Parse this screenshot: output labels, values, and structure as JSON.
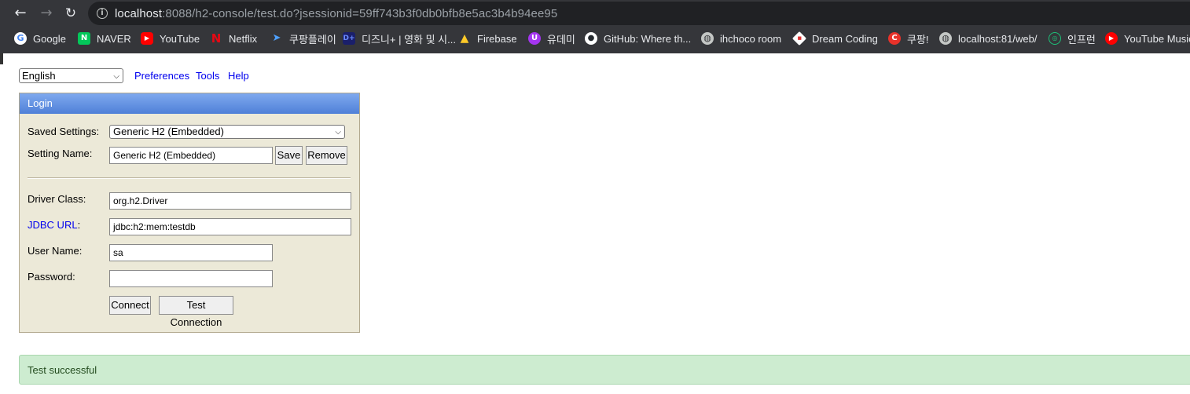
{
  "browser": {
    "url_host": "localhost",
    "url_path": ":8088/h2-console/test.do?jsessionid=59ff743b3f0db0bfb8e5ac3b4b94ee95",
    "bookmarks": [
      {
        "label": "Google",
        "icon": "google-icon"
      },
      {
        "label": "NAVER",
        "icon": "naver-icon"
      },
      {
        "label": "YouTube",
        "icon": "youtube-icon"
      },
      {
        "label": "Netflix",
        "icon": "netflix-icon"
      },
      {
        "label": "쿠팡플레이",
        "icon": "coupang-play-icon"
      },
      {
        "label": "디즈니+ | 영화 및 시...",
        "icon": "disney-plus-icon"
      },
      {
        "label": "Firebase",
        "icon": "firebase-icon"
      },
      {
        "label": "유데미",
        "icon": "udemy-icon"
      },
      {
        "label": "GitHub: Where th...",
        "icon": "github-icon"
      },
      {
        "label": "ihchoco room",
        "icon": "globe-icon"
      },
      {
        "label": "Dream Coding",
        "icon": "dream-coding-icon"
      },
      {
        "label": "쿠팡!",
        "icon": "coupang-icon"
      },
      {
        "label": "localhost:81/web/",
        "icon": "globe-icon"
      },
      {
        "label": "인프런",
        "icon": "inflearn-icon"
      },
      {
        "label": "YouTube Music",
        "icon": "youtube-music-icon"
      }
    ]
  },
  "topbar": {
    "language": "English",
    "links": [
      "Preferences",
      "Tools",
      "Help"
    ]
  },
  "login": {
    "title": "Login",
    "saved_settings_label": "Saved Settings:",
    "saved_settings_value": "Generic H2 (Embedded)",
    "setting_name_label": "Setting Name:",
    "setting_name_value": "Generic H2 (Embedded)",
    "save_button": "Save",
    "remove_button": "Remove",
    "driver_class_label": "Driver Class:",
    "driver_class_value": "org.h2.Driver",
    "jdbc_url_link": "JDBC URL",
    "jdbc_url_colon": ":",
    "jdbc_url_value": "jdbc:h2:mem:testdb",
    "user_name_label": "User Name:",
    "user_name_value": "sa",
    "password_label": "Password:",
    "password_value": "",
    "connect_button": "Connect",
    "test_connection_button": "Test Connection"
  },
  "status": {
    "message": "Test successful"
  }
}
